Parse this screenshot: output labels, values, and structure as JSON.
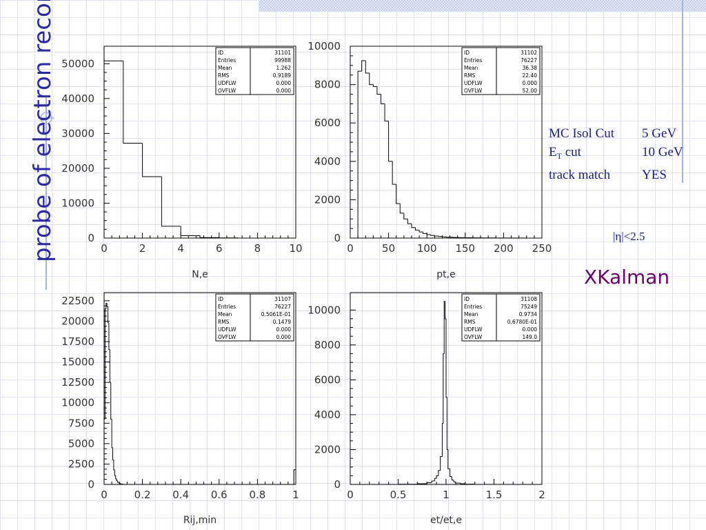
{
  "page": {
    "side_title": "probe of electron reconstruction",
    "cuts": [
      {
        "label": "MC Isol Cut",
        "value": "5 GeV"
      },
      {
        "label": "E",
        "sub": "T",
        "label_rest": " cut",
        "value": "10 GeV"
      },
      {
        "label": "track match",
        "value": "YES"
      }
    ],
    "eta_cut": "|η|<2.5",
    "algorithm": "XKalman"
  },
  "colors": {
    "title": "#2a2aa0",
    "cuts": "#1a1a8c",
    "algorithm": "#6b006b",
    "histogram": "#000000"
  },
  "chart_data": [
    {
      "type": "histogram",
      "xlabel": "N,e",
      "xlim": [
        0,
        10
      ],
      "ylim": [
        0,
        55000
      ],
      "xticks": [
        0,
        2,
        4,
        6,
        8,
        10
      ],
      "xtick_labels": [
        "0",
        "2",
        "4",
        "6",
        "8",
        "10"
      ],
      "yticks": [
        0,
        10000,
        20000,
        30000,
        40000,
        50000
      ],
      "bins": [
        [
          0,
          1,
          50800
        ],
        [
          1,
          2,
          27200
        ],
        [
          2,
          3,
          17600
        ],
        [
          3,
          4,
          3400
        ],
        [
          4,
          5,
          700
        ],
        [
          5,
          6,
          150
        ],
        [
          6,
          7,
          40
        ],
        [
          7,
          8,
          10
        ],
        [
          8,
          9,
          0
        ],
        [
          9,
          10,
          0
        ]
      ],
      "stats": [
        [
          "ID",
          "31101"
        ],
        [
          "Entries",
          "99988"
        ],
        [
          "Mean",
          "1.262"
        ],
        [
          "RMS",
          "0.9189"
        ],
        [
          "UDFLW",
          "0.000"
        ],
        [
          "OVFLW",
          "0.000"
        ]
      ]
    },
    {
      "type": "histogram",
      "xlabel": "pt,e",
      "xlim": [
        0,
        250
      ],
      "ylim": [
        0,
        10000
      ],
      "xticks": [
        0,
        50,
        100,
        150,
        200,
        250
      ],
      "xtick_labels": [
        "0",
        "50",
        "100",
        "150",
        "200",
        "250"
      ],
      "yticks": [
        0,
        2000,
        4000,
        6000,
        8000,
        10000
      ],
      "bins": [
        [
          0,
          10,
          0
        ],
        [
          10,
          15,
          8700
        ],
        [
          15,
          20,
          9250
        ],
        [
          20,
          25,
          8600
        ],
        [
          25,
          30,
          8000
        ],
        [
          30,
          35,
          7900
        ],
        [
          35,
          40,
          7500
        ],
        [
          40,
          45,
          7000
        ],
        [
          45,
          50,
          6100
        ],
        [
          50,
          55,
          4000
        ],
        [
          55,
          60,
          2800
        ],
        [
          60,
          65,
          1800
        ],
        [
          65,
          70,
          1300
        ],
        [
          70,
          75,
          1000
        ],
        [
          75,
          80,
          750
        ],
        [
          80,
          85,
          550
        ],
        [
          85,
          90,
          420
        ],
        [
          90,
          95,
          320
        ],
        [
          95,
          100,
          240
        ],
        [
          100,
          105,
          180
        ],
        [
          105,
          110,
          140
        ],
        [
          110,
          115,
          110
        ],
        [
          115,
          120,
          85
        ],
        [
          120,
          125,
          65
        ],
        [
          125,
          130,
          50
        ],
        [
          130,
          135,
          40
        ],
        [
          135,
          140,
          32
        ],
        [
          140,
          145,
          26
        ],
        [
          145,
          150,
          21
        ],
        [
          150,
          160,
          17
        ],
        [
          160,
          170,
          13
        ],
        [
          170,
          180,
          10
        ],
        [
          180,
          190,
          8
        ],
        [
          190,
          200,
          6
        ],
        [
          200,
          210,
          5
        ],
        [
          210,
          220,
          4
        ],
        [
          220,
          230,
          3
        ],
        [
          230,
          250,
          0
        ]
      ],
      "stats": [
        [
          "ID",
          "31102"
        ],
        [
          "Entries",
          "76227"
        ],
        [
          "Mean",
          "36.38"
        ],
        [
          "RMS",
          "22.40"
        ],
        [
          "UDFLW",
          "0.000"
        ],
        [
          "OVFLW",
          "52.00"
        ]
      ]
    },
    {
      "type": "histogram",
      "xlabel": "Rij,min",
      "xlim": [
        0,
        1
      ],
      "ylim": [
        0,
        23500
      ],
      "xticks": [
        0,
        0.2,
        0.4,
        0.6,
        0.8,
        1
      ],
      "xtick_labels": [
        "0",
        "0.2",
        "0.4",
        "0.6",
        "0.8",
        "1"
      ],
      "yticks": [
        0,
        2500,
        5000,
        7500,
        10000,
        12500,
        15000,
        17500,
        20000,
        22500
      ],
      "bins": [
        [
          0,
          0.005,
          8000
        ],
        [
          0.005,
          0.01,
          21500
        ],
        [
          0.01,
          0.015,
          22200
        ],
        [
          0.015,
          0.02,
          21800
        ],
        [
          0.02,
          0.025,
          19800
        ],
        [
          0.025,
          0.03,
          16500
        ],
        [
          0.03,
          0.035,
          12500
        ],
        [
          0.035,
          0.04,
          8000
        ],
        [
          0.04,
          0.045,
          4500
        ],
        [
          0.045,
          0.05,
          3000
        ],
        [
          0.05,
          0.055,
          1800
        ],
        [
          0.055,
          0.06,
          1100
        ],
        [
          0.06,
          0.065,
          700
        ],
        [
          0.065,
          0.07,
          450
        ],
        [
          0.07,
          0.08,
          250
        ],
        [
          0.08,
          0.09,
          100
        ],
        [
          0.09,
          0.1,
          40
        ],
        [
          0.1,
          0.99,
          0
        ],
        [
          0.99,
          1.0,
          1800
        ]
      ],
      "stats": [
        [
          "ID",
          "31107"
        ],
        [
          "Entries",
          "76227"
        ],
        [
          "Mean",
          "0.5061E-01"
        ],
        [
          "RMS",
          "0.1479"
        ],
        [
          "UDFLW",
          "0.000"
        ],
        [
          "OVFLW",
          "0.000"
        ]
      ]
    },
    {
      "type": "histogram",
      "xlabel": "et/et,e",
      "xlim": [
        0,
        2
      ],
      "ylim": [
        0,
        11000
      ],
      "xticks": [
        0,
        0.5,
        1,
        1.5,
        2
      ],
      "xtick_labels": [
        "0",
        "0.5",
        "1",
        "1.5",
        "2"
      ],
      "yticks": [
        0,
        2000,
        4000,
        6000,
        8000,
        10000
      ],
      "bins": [
        [
          0,
          0.5,
          0
        ],
        [
          0.5,
          0.7,
          10
        ],
        [
          0.7,
          0.8,
          40
        ],
        [
          0.8,
          0.85,
          100
        ],
        [
          0.85,
          0.88,
          200
        ],
        [
          0.88,
          0.9,
          350
        ],
        [
          0.9,
          0.92,
          500
        ],
        [
          0.92,
          0.94,
          800
        ],
        [
          0.94,
          0.96,
          1600
        ],
        [
          0.96,
          0.97,
          3500
        ],
        [
          0.97,
          0.98,
          7500
        ],
        [
          0.98,
          0.99,
          10500
        ],
        [
          0.99,
          1.0,
          9500
        ],
        [
          1.0,
          1.01,
          5000
        ],
        [
          1.01,
          1.02,
          2000
        ],
        [
          1.02,
          1.04,
          900
        ],
        [
          1.04,
          1.06,
          450
        ],
        [
          1.06,
          1.08,
          250
        ],
        [
          1.08,
          1.1,
          150
        ],
        [
          1.1,
          1.15,
          80
        ],
        [
          1.15,
          1.2,
          40
        ],
        [
          1.2,
          1.3,
          15
        ],
        [
          1.3,
          2.0,
          0
        ]
      ],
      "stats": [
        [
          "ID",
          "31108"
        ],
        [
          "Entries",
          "75249"
        ],
        [
          "Mean",
          "0.9734"
        ],
        [
          "RMS",
          "0.6780E-01"
        ],
        [
          "UDFLW",
          "0.000"
        ],
        [
          "OVFLW",
          "149.0"
        ]
      ]
    }
  ]
}
